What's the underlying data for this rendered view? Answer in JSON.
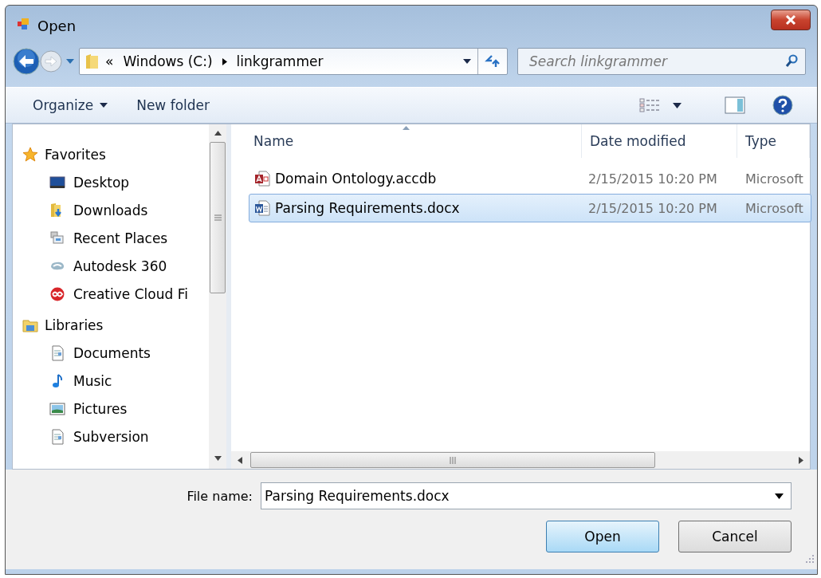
{
  "window": {
    "title": "Open"
  },
  "address": {
    "overflow": "«",
    "crumbs": [
      "Windows (C:)",
      "linkgrammer"
    ]
  },
  "search": {
    "placeholder": "Search linkgrammer"
  },
  "toolbar": [
    {
      "label": "Organize",
      "dropdown": true
    },
    {
      "label": "New folder",
      "dropdown": false
    }
  ],
  "sidebar": {
    "groups": [
      {
        "label": "Favorites",
        "kind": "star",
        "children": [
          {
            "label": "Desktop",
            "kind": "desktop"
          },
          {
            "label": "Downloads",
            "kind": "downloads"
          },
          {
            "label": "Recent Places",
            "kind": "recent"
          },
          {
            "label": "Autodesk 360",
            "kind": "cloud"
          },
          {
            "label": "Creative Cloud Fi",
            "kind": "cc"
          }
        ]
      },
      {
        "label": "Libraries",
        "kind": "library",
        "children": [
          {
            "label": "Documents",
            "kind": "documents"
          },
          {
            "label": "Music",
            "kind": "music"
          },
          {
            "label": "Pictures",
            "kind": "pictures"
          },
          {
            "label": "Subversion",
            "kind": "documents"
          }
        ]
      }
    ]
  },
  "columns": [
    {
      "label": "Name",
      "sorted": true
    },
    {
      "label": "Date modified",
      "sorted": false
    },
    {
      "label": "Type",
      "sorted": false
    }
  ],
  "files": [
    {
      "name": "Domain Ontology.accdb",
      "date": "2/15/2015 10:20 PM",
      "type": "Microsoft",
      "kind": "access",
      "selected": false
    },
    {
      "name": "Parsing Requirements.docx",
      "date": "2/15/2015 10:20 PM",
      "type": "Microsoft",
      "kind": "word",
      "selected": true
    }
  ],
  "file_name": {
    "label": "File name:",
    "value": "Parsing Requirements.docx"
  },
  "buttons": [
    {
      "label": "Open",
      "default": true
    },
    {
      "label": "Cancel",
      "default": false
    }
  ]
}
